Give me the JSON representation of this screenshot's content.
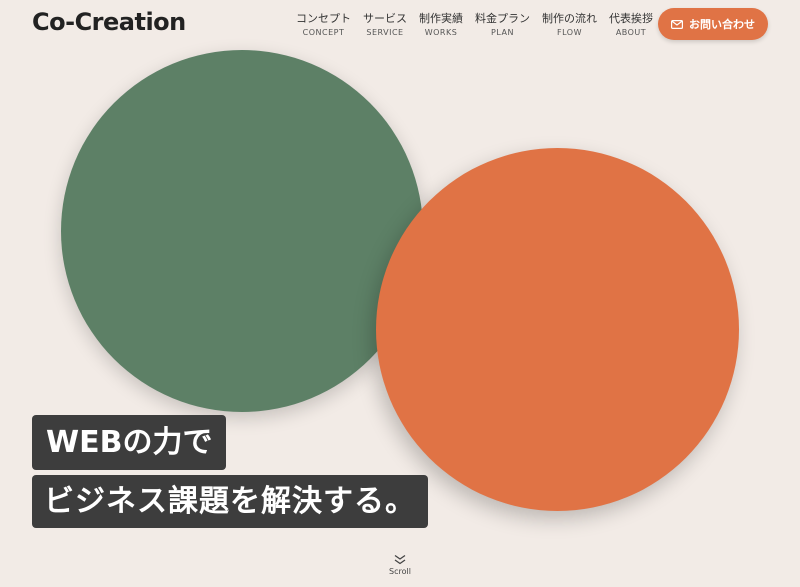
{
  "header": {
    "logo": "Co-Creation",
    "nav": [
      {
        "ja": "コンセプト",
        "en": "CONCEPT"
      },
      {
        "ja": "サービス",
        "en": "SERVICE"
      },
      {
        "ja": "制作実績",
        "en": "WORKS"
      },
      {
        "ja": "料金プラン",
        "en": "PLAN"
      },
      {
        "ja": "制作の流れ",
        "en": "FLOW"
      },
      {
        "ja": "代表挨拶",
        "en": "ABOUT"
      }
    ],
    "contact_label": "お問い合わせ",
    "contact_icon": "mail-icon"
  },
  "hero": {
    "line1": "WEBの力で",
    "line2": "ビジネス課題を解決する。",
    "circle_colors": {
      "green": "#5d8066",
      "orange": "#e07345"
    }
  },
  "scroll": {
    "label": "Scroll",
    "icon": "double-chevron-down-icon"
  },
  "colors": {
    "background": "#f2ebe6",
    "accent": "#e07345",
    "headline_bg": "#3d3d3d"
  }
}
